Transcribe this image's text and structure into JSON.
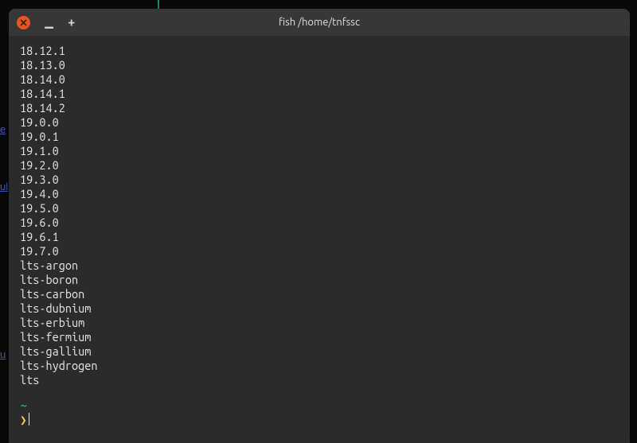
{
  "background": {
    "link1": "e",
    "link2": "ul",
    "link3": "u"
  },
  "window": {
    "title": "fish /home/tnfssc"
  },
  "output_lines": [
    "18.12.1",
    "18.13.0",
    "18.14.0",
    "18.14.1",
    "18.14.2",
    "19.0.0",
    "19.0.1",
    "19.1.0",
    "19.2.0",
    "19.3.0",
    "19.4.0",
    "19.5.0",
    "19.6.0",
    "19.6.1",
    "19.7.0",
    "lts-argon",
    "lts-boron",
    "lts-carbon",
    "lts-dubnium",
    "lts-erbium",
    "lts-fermium",
    "lts-gallium",
    "lts-hydrogen",
    "lts"
  ],
  "prompt": {
    "cwd": "~",
    "symbol": "❯"
  }
}
